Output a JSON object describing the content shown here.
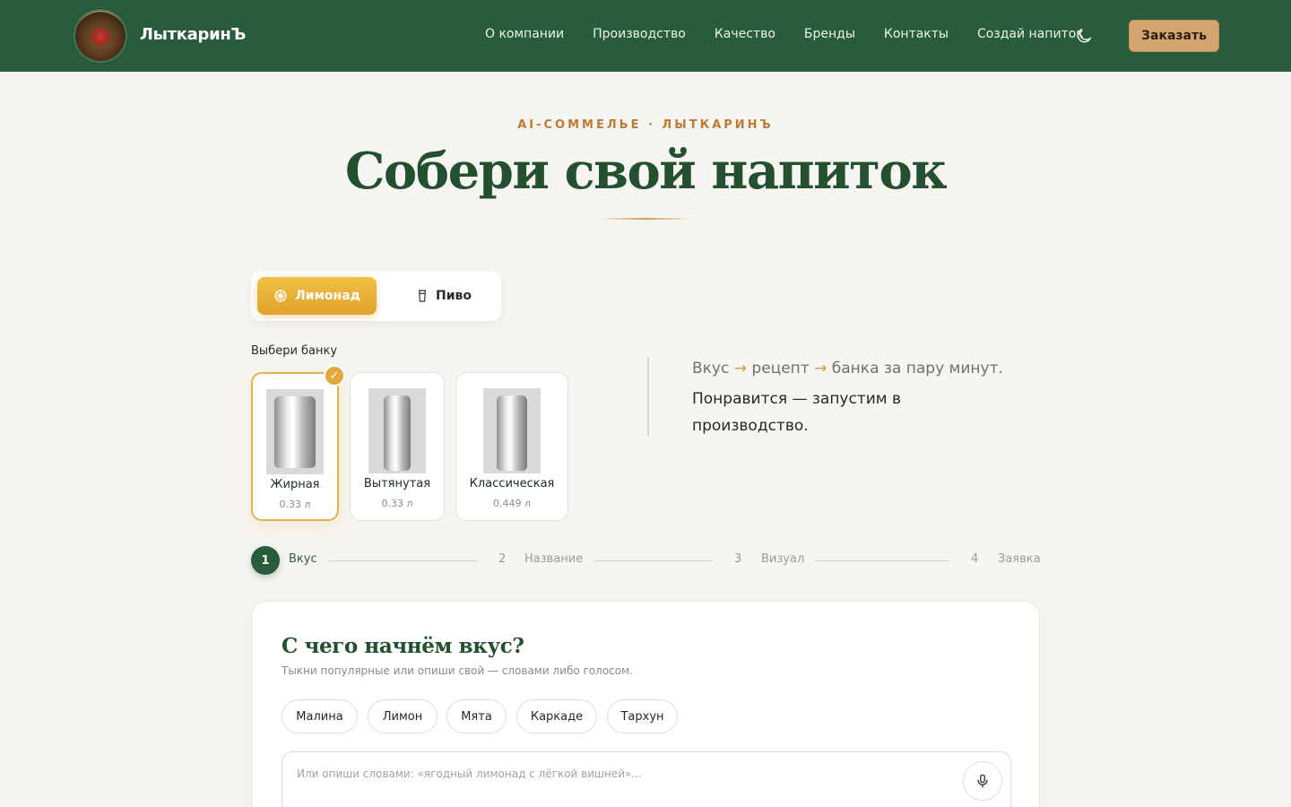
{
  "header": {
    "brand": "ЛыткаринЪ",
    "nav": [
      "О компании",
      "Производство",
      "Качество",
      "Бренды",
      "Контакты",
      "Создай напиток"
    ],
    "order_button": "Заказать"
  },
  "hero": {
    "eyebrow": "AI-СОММЕЛЬЕ · ЛЫТКАРИНЪ",
    "title": "Собери свой напиток"
  },
  "drink_toggle": {
    "options": [
      "Лимонад",
      "Пиво"
    ],
    "selected": "Лимонад"
  },
  "can_picker": {
    "label": "Выбери банку",
    "cans": [
      {
        "name": "Жирная",
        "volume": "0.33 л"
      },
      {
        "name": "Вытянутая",
        "volume": "0.33 л"
      },
      {
        "name": "Классическая",
        "volume": "0.449 л"
      }
    ],
    "selected": "Жирная"
  },
  "tagline": {
    "part1": "Вкус",
    "part2": "рецепт",
    "part3": "банка за пару минут.",
    "line2": "Понравится — запустим в производство."
  },
  "stepper": {
    "steps": [
      {
        "number": "1",
        "label": "Вкус"
      },
      {
        "number": "2",
        "label": "Название"
      },
      {
        "number": "3",
        "label": "Визуал"
      },
      {
        "number": "4",
        "label": "Заявка"
      }
    ],
    "current": 1
  },
  "flavor_step": {
    "title": "С чего начнём вкус?",
    "subtitle": "Тыкни популярные или опиши свой — словами либо голосом.",
    "chips": [
      "Малина",
      "Лимон",
      "Мята",
      "Каркаде",
      "Тархун"
    ],
    "input_placeholder": "Или опиши словами: «ягодный лимонад с лёгкой вишней»..."
  },
  "colors": {
    "header_bg": "#285c3a",
    "accent_gold": "#e0a22b",
    "order_button_bg": "#d4a570",
    "title_green": "#23502f",
    "eyebrow_orange": "#c07a35"
  },
  "icons": {
    "theme": "moon-icon",
    "lemonade": "citrus-slice-icon",
    "beer": "glass-icon",
    "selected": "check-icon",
    "voice": "microphone-icon"
  }
}
